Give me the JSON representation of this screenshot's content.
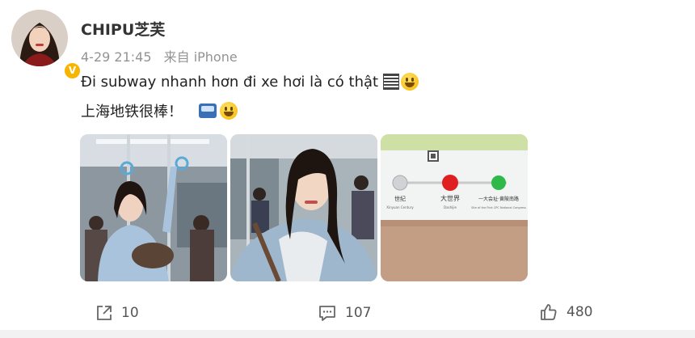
{
  "post": {
    "username": "CHIPU芝芙",
    "timestamp": "4-29 21:45",
    "source": "来自 iPhone",
    "verified_badge": "V",
    "text_line_1": "Đi subway nhanh hơn đi xe hơi là có thật",
    "text_line_2": "上海地铁很棒！",
    "images": [
      {
        "icon": "subway-selfie-photo"
      },
      {
        "icon": "subway-selfie-closeup-photo"
      },
      {
        "icon": "station-indicator-photo",
        "sign_stations": [
          "世纪",
          "大世界",
          "一大会址·黄陂南路"
        ],
        "sign_stations_en": [
          "Xinyuan Century",
          "Dashijie",
          "Site of the First CPC National Congress"
        ]
      }
    ]
  },
  "actions": {
    "repost_count": "10",
    "comment_count": "107",
    "like_count": "480"
  },
  "colors": {
    "verified": "#f7b500",
    "meta_text": "#939393",
    "signal_red": "#e02020",
    "signal_green": "#2fb94a"
  }
}
